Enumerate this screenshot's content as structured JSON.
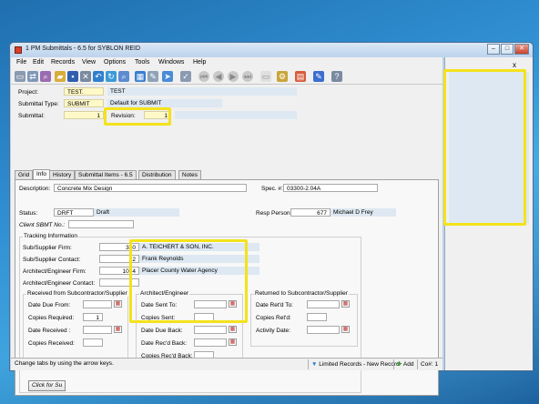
{
  "window": {
    "title": "1 PM Submittals - 6.5 for SYBLON REID",
    "close_glyph": "x"
  },
  "menu": [
    "File",
    "Edit",
    "Records",
    "View",
    "Options",
    "Tools",
    "Windows",
    "Help"
  ],
  "header": {
    "project_label": "Project:",
    "project_code": "TEST.",
    "project_name": "TEST",
    "submittal_type_label": "Submittal Type:",
    "submittal_type_code": "SUBMIT",
    "submittal_type_name": "Default for SUBMIT",
    "submittal_label": "Submittal:",
    "submittal_value": "1",
    "revision_label": "Revision:",
    "revision_value": "1"
  },
  "tabs": [
    "Grid",
    "Info",
    "History",
    "Submittal Items - 6.5",
    "Distribution",
    "Notes"
  ],
  "info": {
    "description_label": "Description:",
    "description_value": "Concrete Mix Design",
    "spec_label": "Spec. #:",
    "spec_value": "03300-2.04A",
    "status_label": "Status:",
    "status_code": "DRFT",
    "status_name": "Draft",
    "resp_label": "Resp Person:",
    "resp_id": "677",
    "resp_name": "Michael D Frey",
    "client_label": "Client SBMT No.:",
    "client_value": "",
    "tracking_title": "Tracking Information",
    "sub_firm_label": "Sub/Supplier Firm:",
    "sub_firm_id": "340",
    "sub_firm_name": "A. TEICHERT & SON, INC.",
    "sub_contact_label": "Sub/Supplier Contact:",
    "sub_contact_id": "2",
    "sub_contact_name": "Frank Reynolds",
    "arch_firm_label": "Architect/Engineer Firm:",
    "arch_firm_id": "1054",
    "arch_firm_name": "Placer County Water Agency",
    "arch_contact_label": "Architect/Engineer Contact:",
    "arch_contact_value": ""
  },
  "received": {
    "title": "Received from Subcontractor/Supplier",
    "date_due_label": "Date Due From:",
    "copies_required_label": "Copies Required:",
    "copies_required_value": "1",
    "date_received_label": "Date Received :",
    "copies_received_label": "Copies Received:"
  },
  "architect": {
    "title": "Architect/Engineer",
    "date_sent_label": "Date Sent To:",
    "copies_sent_label": "Copies Sent:",
    "date_due_back_label": "Date Due Back:",
    "date_recd_back_label": "Date Rec'd Back:",
    "copies_recd_back_label": "Copies Rec'd Back:"
  },
  "returned": {
    "title": "Returned to Subcontractor/Supplier",
    "date_retd_label": "Date Ret'd To:",
    "copies_retd_label": "Copies Ret'd:",
    "activity_label": "Activity Date:"
  },
  "button_click": "Click for Su",
  "status": {
    "hint": "Change tabs by using the arrow keys.",
    "records": "Limited Records - New Record",
    "add": "Add",
    "co": "Co#: 1"
  },
  "colors": {
    "highlight": "#f4e21c",
    "yellow_field": "#fff9c8",
    "blue_field": "#dde8f2"
  }
}
